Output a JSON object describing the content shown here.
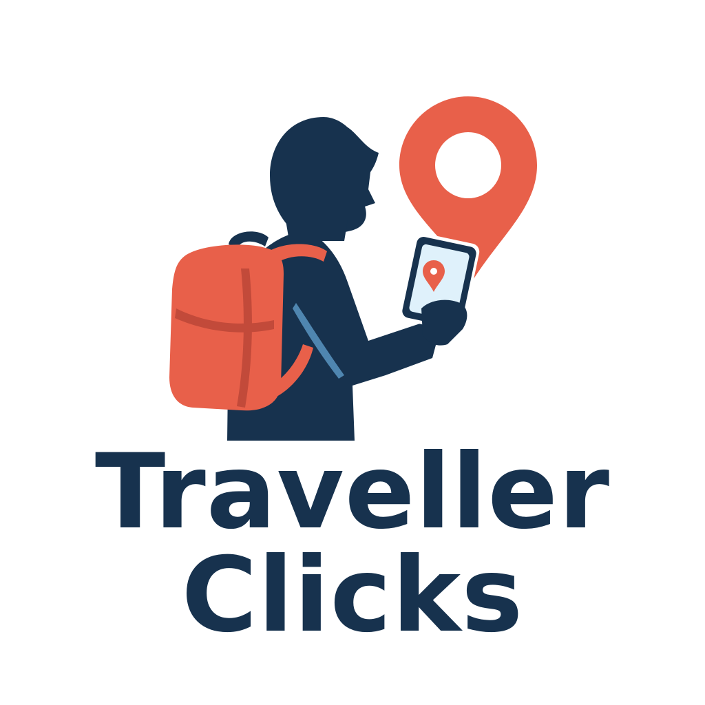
{
  "brand": {
    "line1": "Traveller",
    "line2": "Clicks"
  },
  "colors": {
    "navy": "#17324e",
    "coral": "#e8604a",
    "coral_dark": "#c24a3a",
    "screen": "#dff1fb",
    "strap_shadow": "#4f86b0",
    "background": "#ffffff"
  },
  "icons": {
    "emblem": "backpacker-with-phone-icon",
    "pin": "map-pin-icon"
  }
}
